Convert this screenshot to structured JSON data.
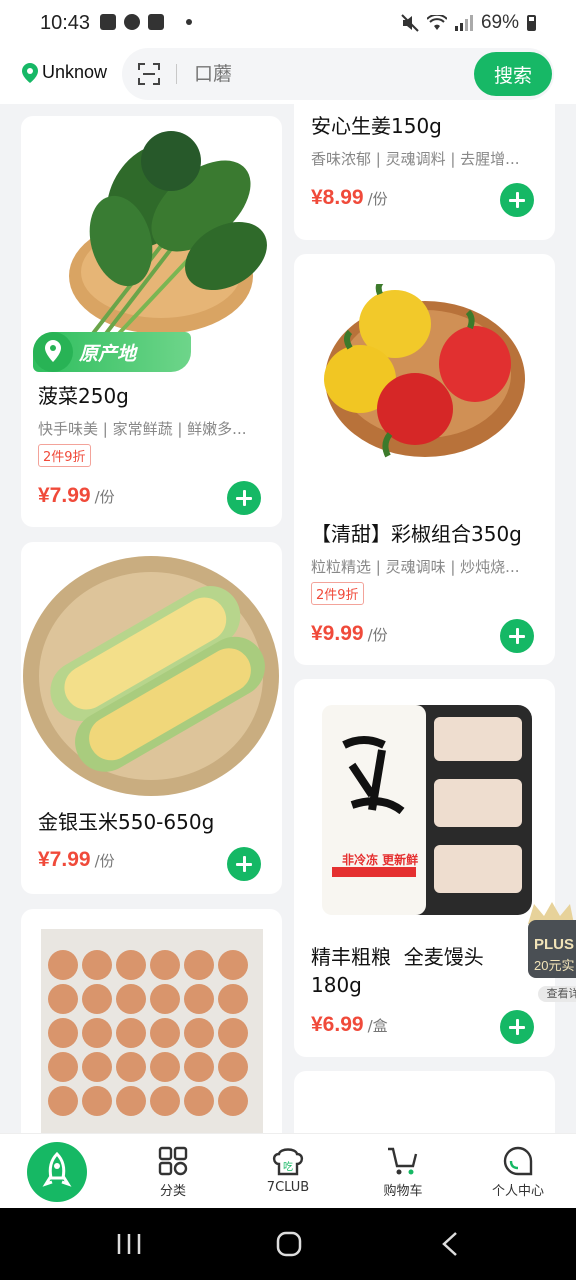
{
  "status_bar": {
    "time": "10:43",
    "battery": "69%",
    "icons": [
      "image-icon",
      "cloud-icon",
      "check-icon",
      "dot-icon",
      "mute-icon",
      "wifi-icon",
      "signal-icon",
      "battery-icon"
    ]
  },
  "header": {
    "location": "Unknow",
    "search_placeholder": "口蘑",
    "search_button": "搜索"
  },
  "products": [
    {
      "name": "菠菜250g",
      "desc": "快手味美 | 家常鲜蔬 | 鲜嫩多...",
      "badge": "原产地",
      "promo": "2件9折",
      "price": "¥7.99",
      "unit": "/份"
    },
    {
      "name": "金银玉米550-650g",
      "price": "¥7.99",
      "unit": "/份"
    },
    {
      "name": "安心生姜150g",
      "desc": "香味浓郁 | 灵魂调料 | 去腥增...",
      "price": "¥8.99",
      "unit": "/份"
    },
    {
      "name": "【清甜】彩椒组合350g",
      "desc": "粒粒精选 | 灵魂调味 | 炒炖烧...",
      "promo": "2件9折",
      "price": "¥9.99",
      "unit": "/份"
    },
    {
      "name": "精丰粗粮  全麦馒头",
      "name2": "180g",
      "price": "¥6.99",
      "unit": "/盒",
      "package_text": "非冷冻 更新鲜"
    }
  ],
  "plus_widget": {
    "title": "PLUS",
    "subtitle": "20元实",
    "button": "查看详"
  },
  "bottom_nav": {
    "items": [
      {
        "label": "分类",
        "icon": "category-icon"
      },
      {
        "label": "7CLUB",
        "icon": "chef-hat-icon"
      },
      {
        "label": "购物车",
        "icon": "cart-icon"
      },
      {
        "label": "个人中心",
        "icon": "profile-icon"
      }
    ]
  },
  "colors": {
    "brand_green": "#17b866",
    "price_red": "#f04a3a"
  }
}
